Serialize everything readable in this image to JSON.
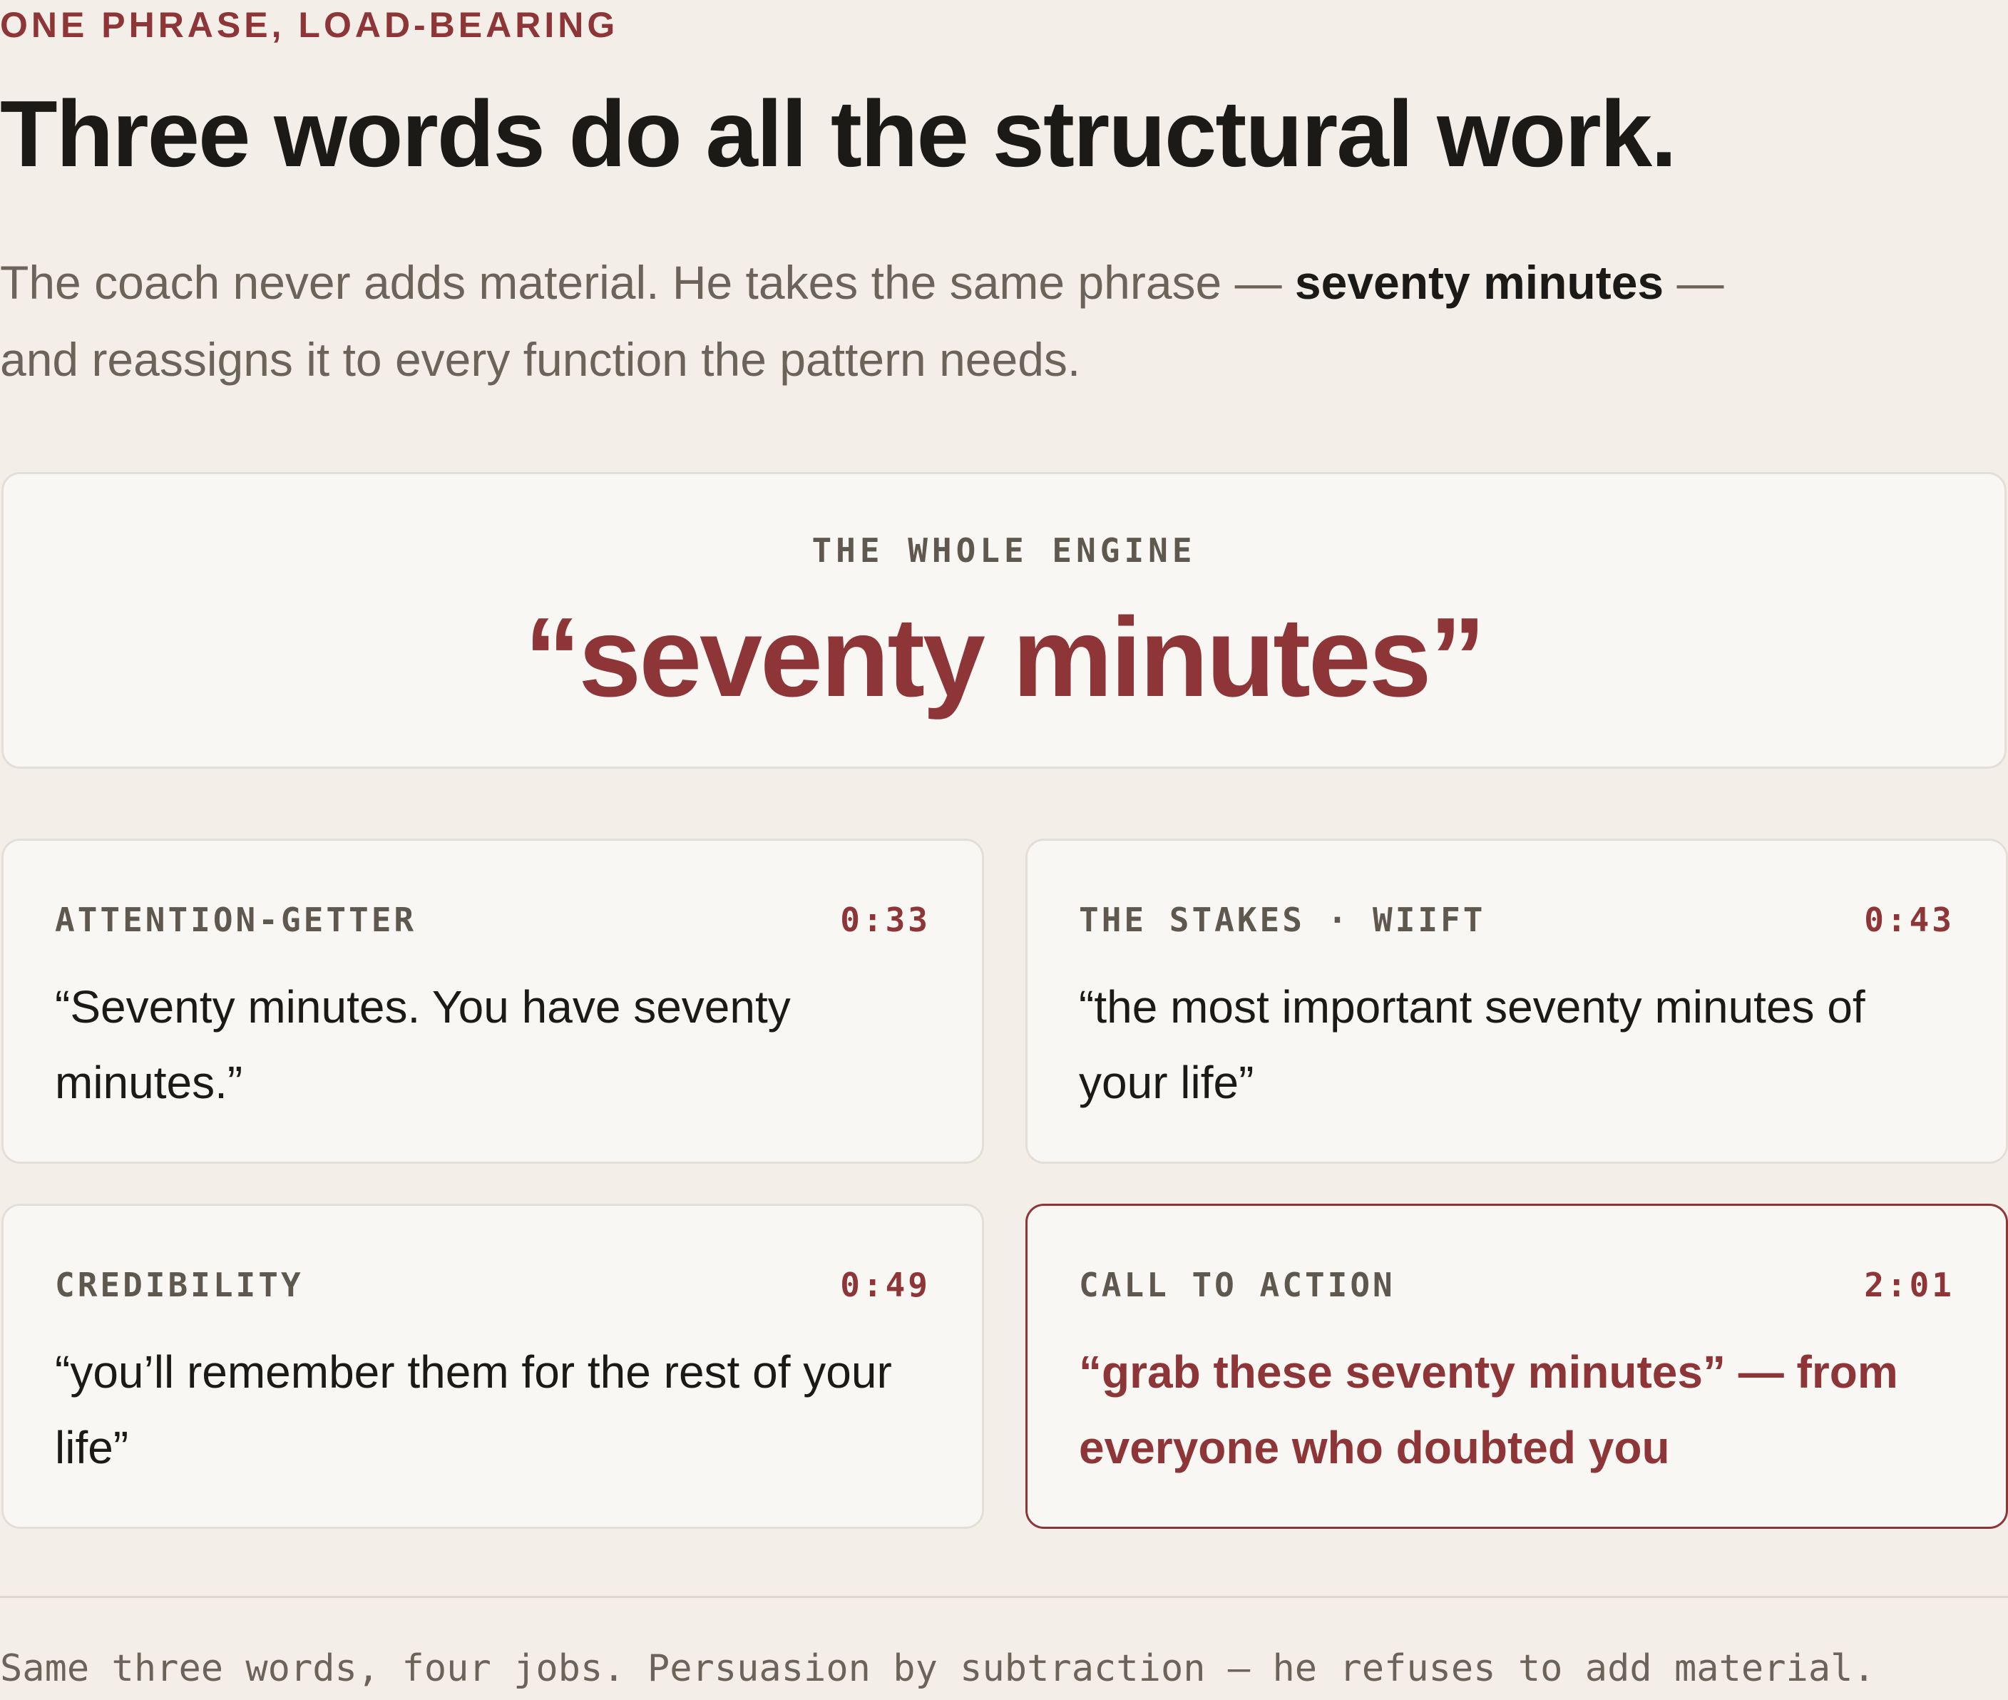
{
  "kicker": "ONE PHRASE, LOAD-BEARING",
  "title": "Three words do all the structural work.",
  "intro": {
    "before": "The coach never adds material. He takes the same phrase — ",
    "emphasis": "seventy minutes",
    "after": " — and reassigns it to every function the pattern needs."
  },
  "engine": {
    "label": "THE WHOLE ENGINE",
    "phrase": "“seventy minutes”"
  },
  "jobs": [
    {
      "label": "ATTENTION-GETTER",
      "time": "0:33",
      "quote": "“Seventy minutes. You have seventy minutes.”",
      "highlighted": false
    },
    {
      "label": "THE STAKES · WIIFT",
      "time": "0:43",
      "quote": "“the most important seventy minutes of your life”",
      "highlighted": false
    },
    {
      "label": "CREDIBILITY",
      "time": "0:49",
      "quote": "“you’ll remember them for the rest of your life”",
      "highlighted": false
    },
    {
      "label": "CALL TO ACTION",
      "time": "2:01",
      "quote": "“grab these seventy minutes” — from everyone who doubted you",
      "highlighted": true
    }
  ],
  "footnote": "Same three words, four jobs. Persuasion by subtraction — he refuses to add material.",
  "colors": {
    "accent": "#8e3538",
    "background": "#f3efe8",
    "card": "#f9f7f4"
  }
}
